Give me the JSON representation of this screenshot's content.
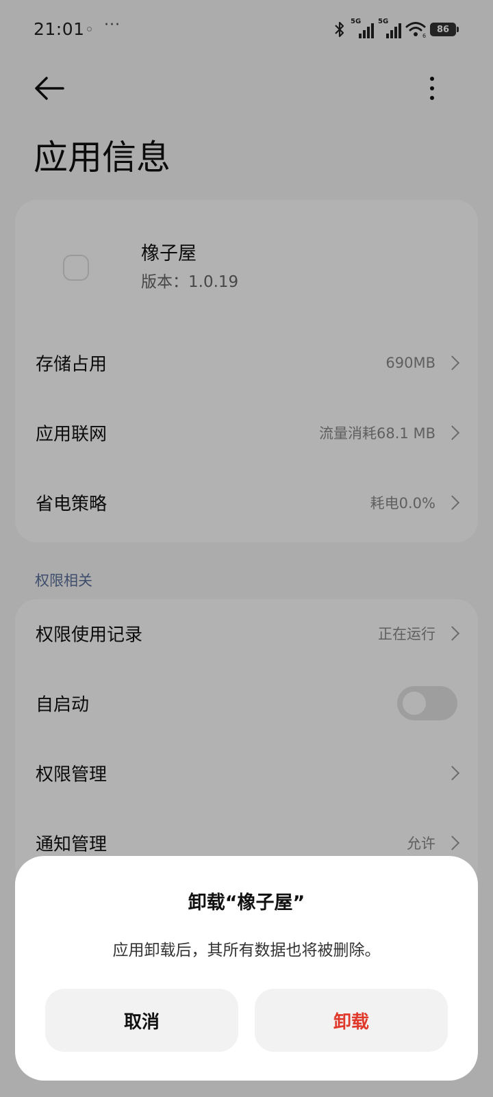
{
  "status_bar": {
    "time": "21:01",
    "more": "···",
    "network_1": "5G",
    "network_2": "5G",
    "wifi_sub": "6",
    "battery": "86"
  },
  "header": {
    "title": "应用信息"
  },
  "app": {
    "name": "橡子屋",
    "version": "版本：1.0.19"
  },
  "main_rows": [
    {
      "label": "存储占用",
      "value": "690MB"
    },
    {
      "label": "应用联网",
      "value": "流量消耗68.1 MB"
    },
    {
      "label": "省电策略",
      "value": "耗电0.0%"
    }
  ],
  "permissions": {
    "section_title": "权限相关",
    "rows": [
      {
        "label": "权限使用记录",
        "value": "正在运行"
      },
      {
        "label": "自启动",
        "toggle_on": false
      },
      {
        "label": "权限管理",
        "value": ""
      },
      {
        "label": "通知管理",
        "value": "允许"
      }
    ]
  },
  "dialog": {
    "title": "卸载“橡子屋”",
    "message": "应用卸载后，其所有数据也将被删除。",
    "cancel_label": "取消",
    "uninstall_label": "卸载"
  },
  "colors": {
    "accent_danger": "#e0392b",
    "section_header": "#5a6f9a"
  }
}
